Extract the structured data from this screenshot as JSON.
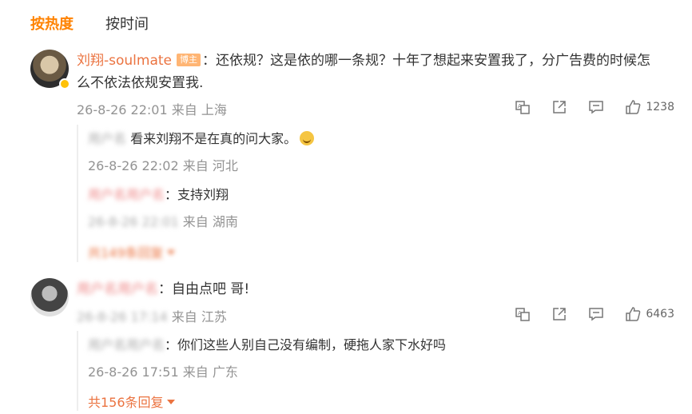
{
  "tabs": {
    "hot": "按热度",
    "time": "按时间"
  },
  "comments": [
    {
      "username": "刘翔-soulmate",
      "tag": "博主",
      "text_line1": "：还依规？这是依的哪一条规？十年了想起来安置我了，分广告费的时候怎",
      "text_line2": "么不依法依规安置我.",
      "time": "26-8-26 22:01",
      "from": "来自 上海",
      "likes": "1238",
      "replies": [
        {
          "username": "用户名",
          "text": "看来刘翔不是在真的问大家。",
          "time": "26-8-26 22:02",
          "from": "来自 河北"
        },
        {
          "username": "用户名用户名",
          "text": "：支持刘翔",
          "time": "26-8-26 22:01",
          "from": "来自 湖南"
        }
      ],
      "more_replies": "共149条回复"
    },
    {
      "username": "用户名用户名",
      "text": "：自由点吧 哥!",
      "time": "26-8-26 17:14",
      "from": "来自 江苏",
      "likes": "6463",
      "replies": [
        {
          "username": "用户名用户名",
          "text": "：你们这些人别自己没有编制，硬拖人家下水好吗",
          "time": "26-8-26 17:51",
          "from": "来自 广东"
        }
      ],
      "more_replies": "共156条回复"
    }
  ],
  "icons": {
    "translate": "translate-icon",
    "share": "share-icon",
    "comment": "comment-icon",
    "like": "thumbs-up-icon"
  },
  "colors": {
    "accent": "#ff8200",
    "username": "#eb7340",
    "meta": "#939393"
  }
}
